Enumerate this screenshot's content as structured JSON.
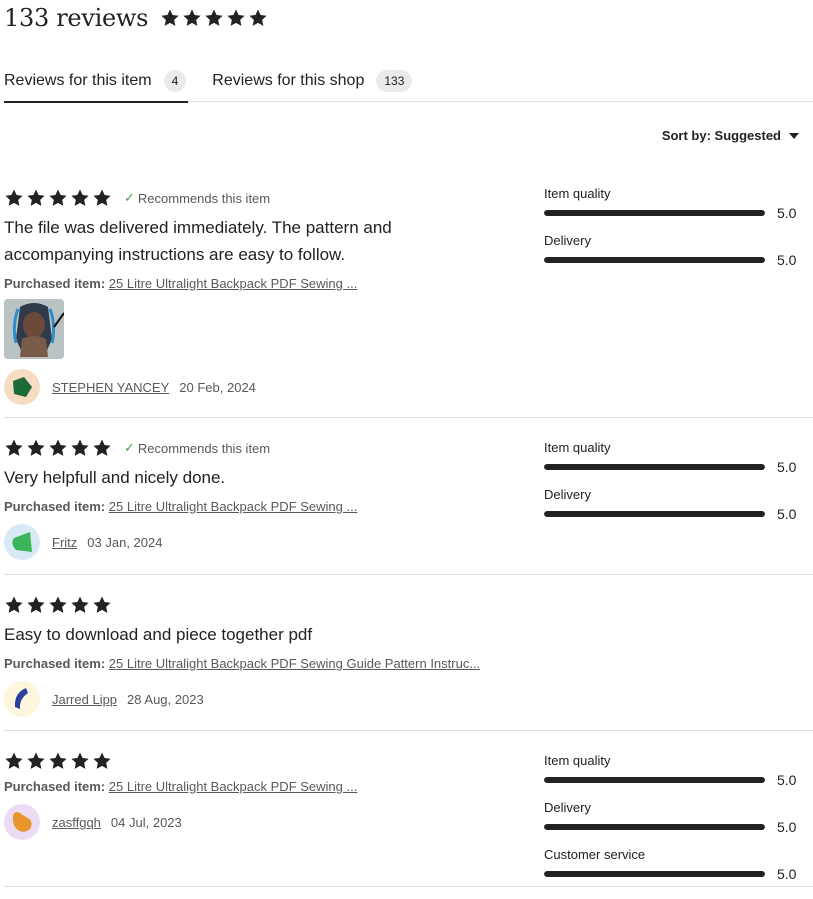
{
  "header": {
    "title": "133 reviews",
    "stars": 5
  },
  "tabs": [
    {
      "label": "Reviews for this item",
      "count": "4",
      "active": true
    },
    {
      "label": "Reviews for this shop",
      "count": "133",
      "active": false
    }
  ],
  "sort": {
    "label": "Sort by: Suggested"
  },
  "purchased_label": "Purchased item:",
  "recommends_label": "Recommends this item",
  "reviews": [
    {
      "stars": 5,
      "recommends": true,
      "text": "The file was delivered immediately. The pattern and accompanying instructions are easy to follow.",
      "purchased_item": "25 Litre Ultralight Backpack PDF Sewing ...",
      "has_photo": true,
      "reviewer": "STEPHEN YANCEY",
      "date": "20 Feb, 2024",
      "avatar_bg": "#f5dcc2",
      "avatar_fg": "#1e6b3a",
      "ratings": [
        {
          "label": "Item quality",
          "value": "5.0",
          "fraction": 1.0
        },
        {
          "label": "Delivery",
          "value": "5.0",
          "fraction": 1.0
        }
      ]
    },
    {
      "stars": 5,
      "recommends": true,
      "text": "Very helpfull and nicely done.",
      "purchased_item": "25 Litre Ultralight Backpack PDF Sewing ...",
      "has_photo": false,
      "reviewer": "Fritz",
      "date": "03 Jan, 2024",
      "avatar_bg": "#d6e9f5",
      "avatar_fg": "#3cb55a",
      "ratings": [
        {
          "label": "Item quality",
          "value": "5.0",
          "fraction": 1.0
        },
        {
          "label": "Delivery",
          "value": "5.0",
          "fraction": 1.0
        }
      ]
    },
    {
      "stars": 5,
      "recommends": false,
      "text": "Easy to download and piece together pdf",
      "purchased_item": "25 Litre Ultralight Backpack PDF Sewing Guide Pattern Instruc...",
      "has_photo": false,
      "reviewer": "Jarred Lipp",
      "date": "28 Aug, 2023",
      "avatar_bg": "#fdf6dc",
      "avatar_fg": "#2a3f9e",
      "ratings": []
    },
    {
      "stars": 5,
      "recommends": false,
      "text": "",
      "purchased_item": "25 Litre Ultralight Backpack PDF Sewing ...",
      "has_photo": false,
      "reviewer": "zasffgqh",
      "date": "04 Jul, 2023",
      "avatar_bg": "#ecdcf3",
      "avatar_fg": "#e8962e",
      "ratings": [
        {
          "label": "Item quality",
          "value": "5.0",
          "fraction": 1.0
        },
        {
          "label": "Delivery",
          "value": "5.0",
          "fraction": 1.0
        },
        {
          "label": "Customer service",
          "value": "5.0",
          "fraction": 1.0
        }
      ]
    }
  ],
  "colors": {
    "star": "#222222",
    "check": "#4d9e4d",
    "bar": "#222222",
    "bar_track": "#e0e0e0"
  }
}
